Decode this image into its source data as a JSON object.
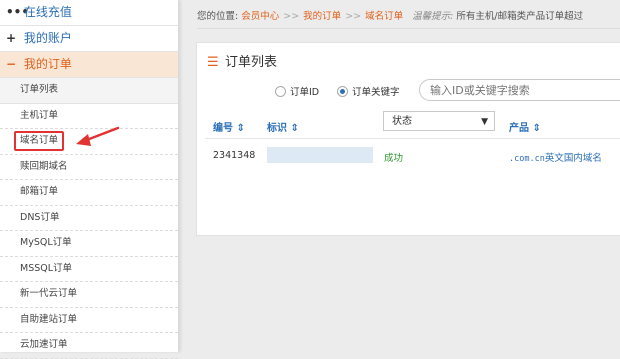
{
  "sidebar": {
    "groups": [
      {
        "icon": "•••",
        "label": "在线充值"
      },
      {
        "icon": "+",
        "label": "我的账户"
      },
      {
        "icon": "−",
        "label": "我的订单"
      }
    ],
    "items": [
      {
        "label": "订单列表"
      },
      {
        "label": "主机订单"
      },
      {
        "label": "域名订单"
      },
      {
        "label": "赎回期域名"
      },
      {
        "label": "邮箱订单"
      },
      {
        "label": "DNS订单"
      },
      {
        "label": "MySQL订单"
      },
      {
        "label": "MSSQL订单"
      },
      {
        "label": "新一代云订单"
      },
      {
        "label": "自助建站订单"
      },
      {
        "label": "云加速订单"
      }
    ]
  },
  "breadcrumb": {
    "prefix": "您的位置:",
    "crumbs": [
      "会员中心",
      "我的订单",
      "域名订单"
    ],
    "separator": ">>",
    "tip_label": "温馨提示:",
    "tip_text": "所有主机/邮箱类产品订单超过"
  },
  "panel": {
    "title": "订单列表",
    "radio_id": "订单ID",
    "radio_keyword": "订单关键字",
    "search_placeholder": "输入ID或关键字搜索"
  },
  "table": {
    "headers": {
      "id": "编号 ⇕",
      "tag": "标识 ⇕",
      "status": "状态",
      "product": "产品 ⇕"
    },
    "rows": [
      {
        "id": "2341348",
        "status": "成功",
        "product_domain": ".com.cn",
        "product_name": "英文国内域名",
        "extra": "1"
      }
    ]
  }
}
